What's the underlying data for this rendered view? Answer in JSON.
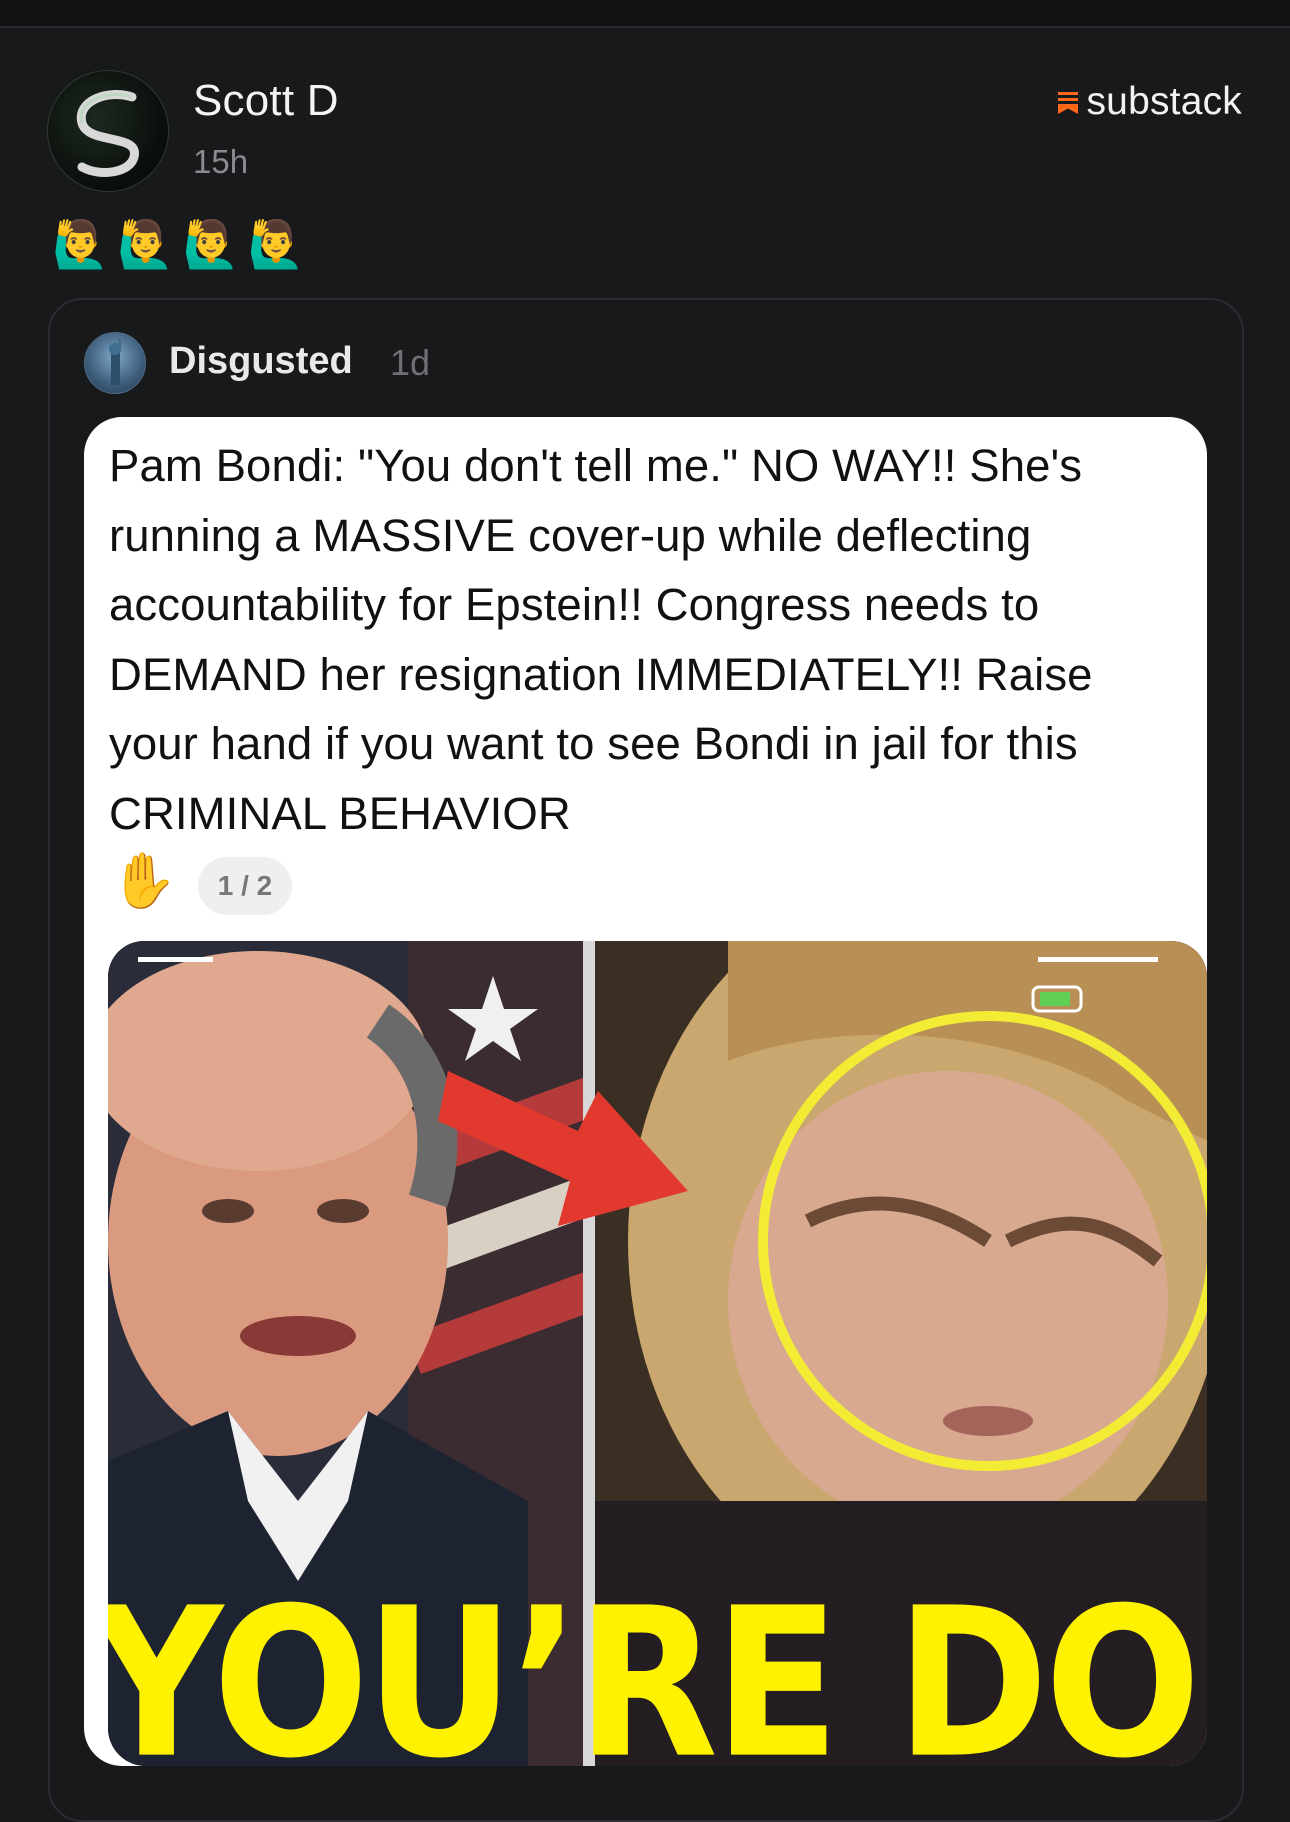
{
  "post": {
    "author": "Scott D",
    "time": "15h",
    "brand": "substack",
    "emoji": "🙋‍♂️🙋‍♂️🙋‍♂️🙋‍♂️"
  },
  "quote": {
    "author": "Disgusted",
    "time": "1d",
    "screenshot": {
      "text": "Pam Bondi: \"You don't tell me.\" NO WAY!! She's running a MASSIVE cover-up while deflecting accountability for Epstein!! Congress needs to DEMAND her resignation IMMEDIATELY!! Raise your hand if you want to see Bondi in jail for this CRIMINAL BEHAVIOR",
      "hand_emoji": "✋",
      "counter": "1 / 2",
      "photo_caption": "YOU’RE DONE PAM"
    }
  },
  "colors": {
    "background": "#18191b",
    "brand_accent": "#ff6719",
    "caption_yellow": "#fff200",
    "circle_yellow": "#f3ec34",
    "arrow_red": "#e2392f"
  }
}
